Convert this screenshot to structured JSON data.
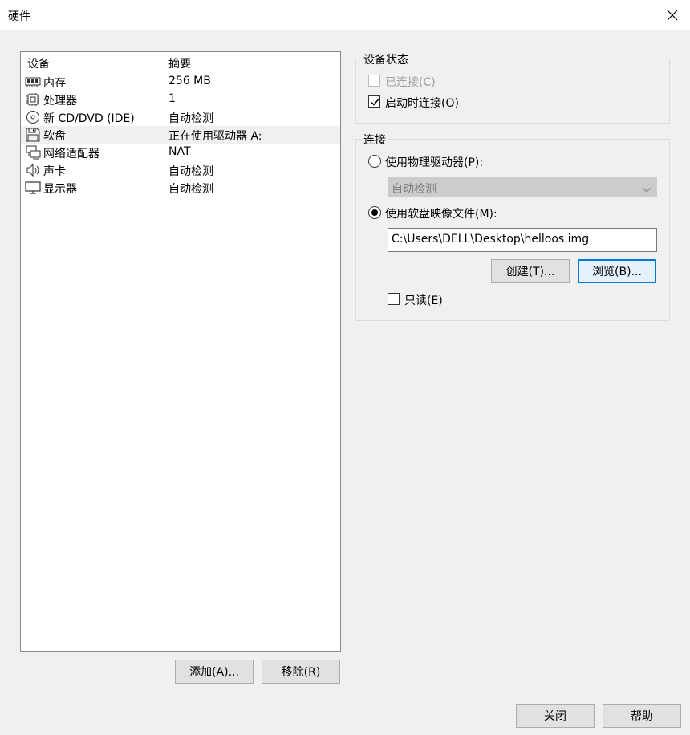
{
  "window": {
    "title": "硬件",
    "close_icon": "close-icon"
  },
  "device_list": {
    "columns": [
      "设备",
      "摘要"
    ],
    "items": [
      {
        "icon": "memory-icon",
        "name": "内存",
        "summary": "256 MB"
      },
      {
        "icon": "processor-icon",
        "name": "处理器",
        "summary": "1"
      },
      {
        "icon": "cd-dvd-icon",
        "name": "新 CD/DVD (IDE)",
        "summary": "自动检测"
      },
      {
        "icon": "floppy-icon",
        "name": "软盘",
        "summary": "正在使用驱动器 A:"
      },
      {
        "icon": "network-icon",
        "name": "网络适配器",
        "summary": "NAT"
      },
      {
        "icon": "speaker-icon",
        "name": "声卡",
        "summary": "自动检测"
      },
      {
        "icon": "display-icon",
        "name": "显示器",
        "summary": "自动检测"
      }
    ],
    "selected_index": 3
  },
  "list_buttons": {
    "add": "添加(A)...",
    "remove": "移除(R)"
  },
  "device_status": {
    "label": "设备状态",
    "connected": {
      "label": "已连接(C)",
      "checked": false,
      "disabled": true
    },
    "connect_on_power_on": {
      "label": "启动时连接(O)",
      "checked": true,
      "disabled": false
    }
  },
  "connection": {
    "label": "连接",
    "use_physical_drive": {
      "label": "使用物理驱动器(P):",
      "selected": false
    },
    "physical_drive_select": {
      "value": "自动检测",
      "disabled": true
    },
    "use_image_file": {
      "label": "使用软盘映像文件(M):",
      "selected": true
    },
    "image_path": "C:\\Users\\DELL\\Desktop\\helloos.img",
    "create_button": "创建(T)...",
    "browse_button": "浏览(B)...",
    "read_only": {
      "label": "只读(E)",
      "checked": false
    }
  },
  "footer": {
    "close_button": "关闭",
    "help_button": "帮助"
  }
}
